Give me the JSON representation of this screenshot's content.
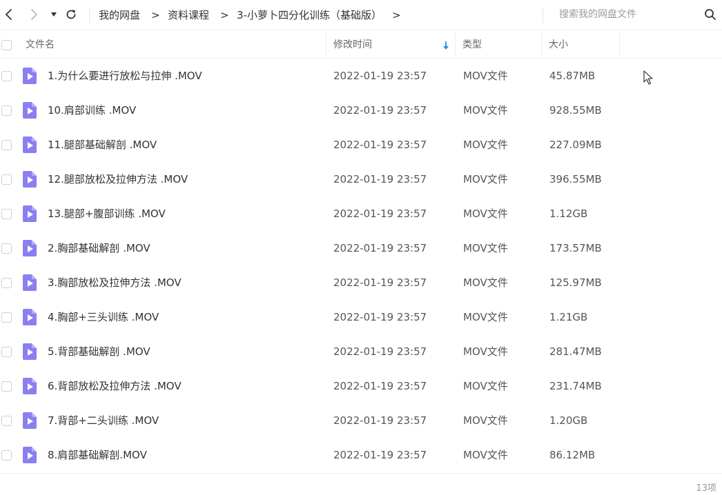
{
  "toolbar": {
    "back_icon": "chevron-left-icon",
    "forward_icon": "chevron-right-icon",
    "history_icon": "caret-down-icon",
    "refresh_icon": "refresh-icon"
  },
  "breadcrumb": {
    "items": [
      "我的网盘",
      "资料课程",
      "3-小萝卜四分化训练（基础版）"
    ],
    "separator": ">"
  },
  "search": {
    "placeholder": "搜索我的网盘文件",
    "value": "",
    "icon": "search-icon"
  },
  "table": {
    "headers": {
      "name": "文件名",
      "modified": "修改时间",
      "type": "类型",
      "size": "大小"
    },
    "sort": {
      "column": "modified",
      "direction": "down"
    },
    "rows": [
      {
        "name": "1.为什么要进行放松与拉伸 .MOV",
        "modified": "2022-01-19 23:57",
        "type": "MOV文件",
        "size": "45.87MB"
      },
      {
        "name": "10.肩部训练 .MOV",
        "modified": "2022-01-19 23:57",
        "type": "MOV文件",
        "size": "928.55MB"
      },
      {
        "name": "11.腿部基础解剖 .MOV",
        "modified": "2022-01-19 23:57",
        "type": "MOV文件",
        "size": "227.09MB"
      },
      {
        "name": "12.腿部放松及拉伸方法 .MOV",
        "modified": "2022-01-19 23:57",
        "type": "MOV文件",
        "size": "396.55MB"
      },
      {
        "name": "13.腿部+腹部训练 .MOV",
        "modified": "2022-01-19 23:57",
        "type": "MOV文件",
        "size": "1.12GB"
      },
      {
        "name": "2.胸部基础解剖 .MOV",
        "modified": "2022-01-19 23:57",
        "type": "MOV文件",
        "size": "173.57MB"
      },
      {
        "name": "3.胸部放松及拉伸方法 .MOV",
        "modified": "2022-01-19 23:57",
        "type": "MOV文件",
        "size": "125.97MB"
      },
      {
        "name": "4.胸部+三头训练 .MOV",
        "modified": "2022-01-19 23:57",
        "type": "MOV文件",
        "size": "1.21GB"
      },
      {
        "name": "5.背部基础解剖 .MOV",
        "modified": "2022-01-19 23:57",
        "type": "MOV文件",
        "size": "281.47MB"
      },
      {
        "name": "6.背部放松及拉伸方法 .MOV",
        "modified": "2022-01-19 23:57",
        "type": "MOV文件",
        "size": "231.74MB"
      },
      {
        "name": "7.背部+二头训练 .MOV",
        "modified": "2022-01-19 23:57",
        "type": "MOV文件",
        "size": "1.20GB"
      },
      {
        "name": "8.肩部基础解剖.MOV",
        "modified": "2022-01-19 23:57",
        "type": "MOV文件",
        "size": "86.12MB"
      }
    ],
    "file_icon": "video-file-icon"
  },
  "footer": {
    "count": "13项"
  },
  "colors": {
    "accent": "#2b8be8",
    "file_icon": "#8a7ff0",
    "text": "#333333",
    "muted": "#999999"
  }
}
